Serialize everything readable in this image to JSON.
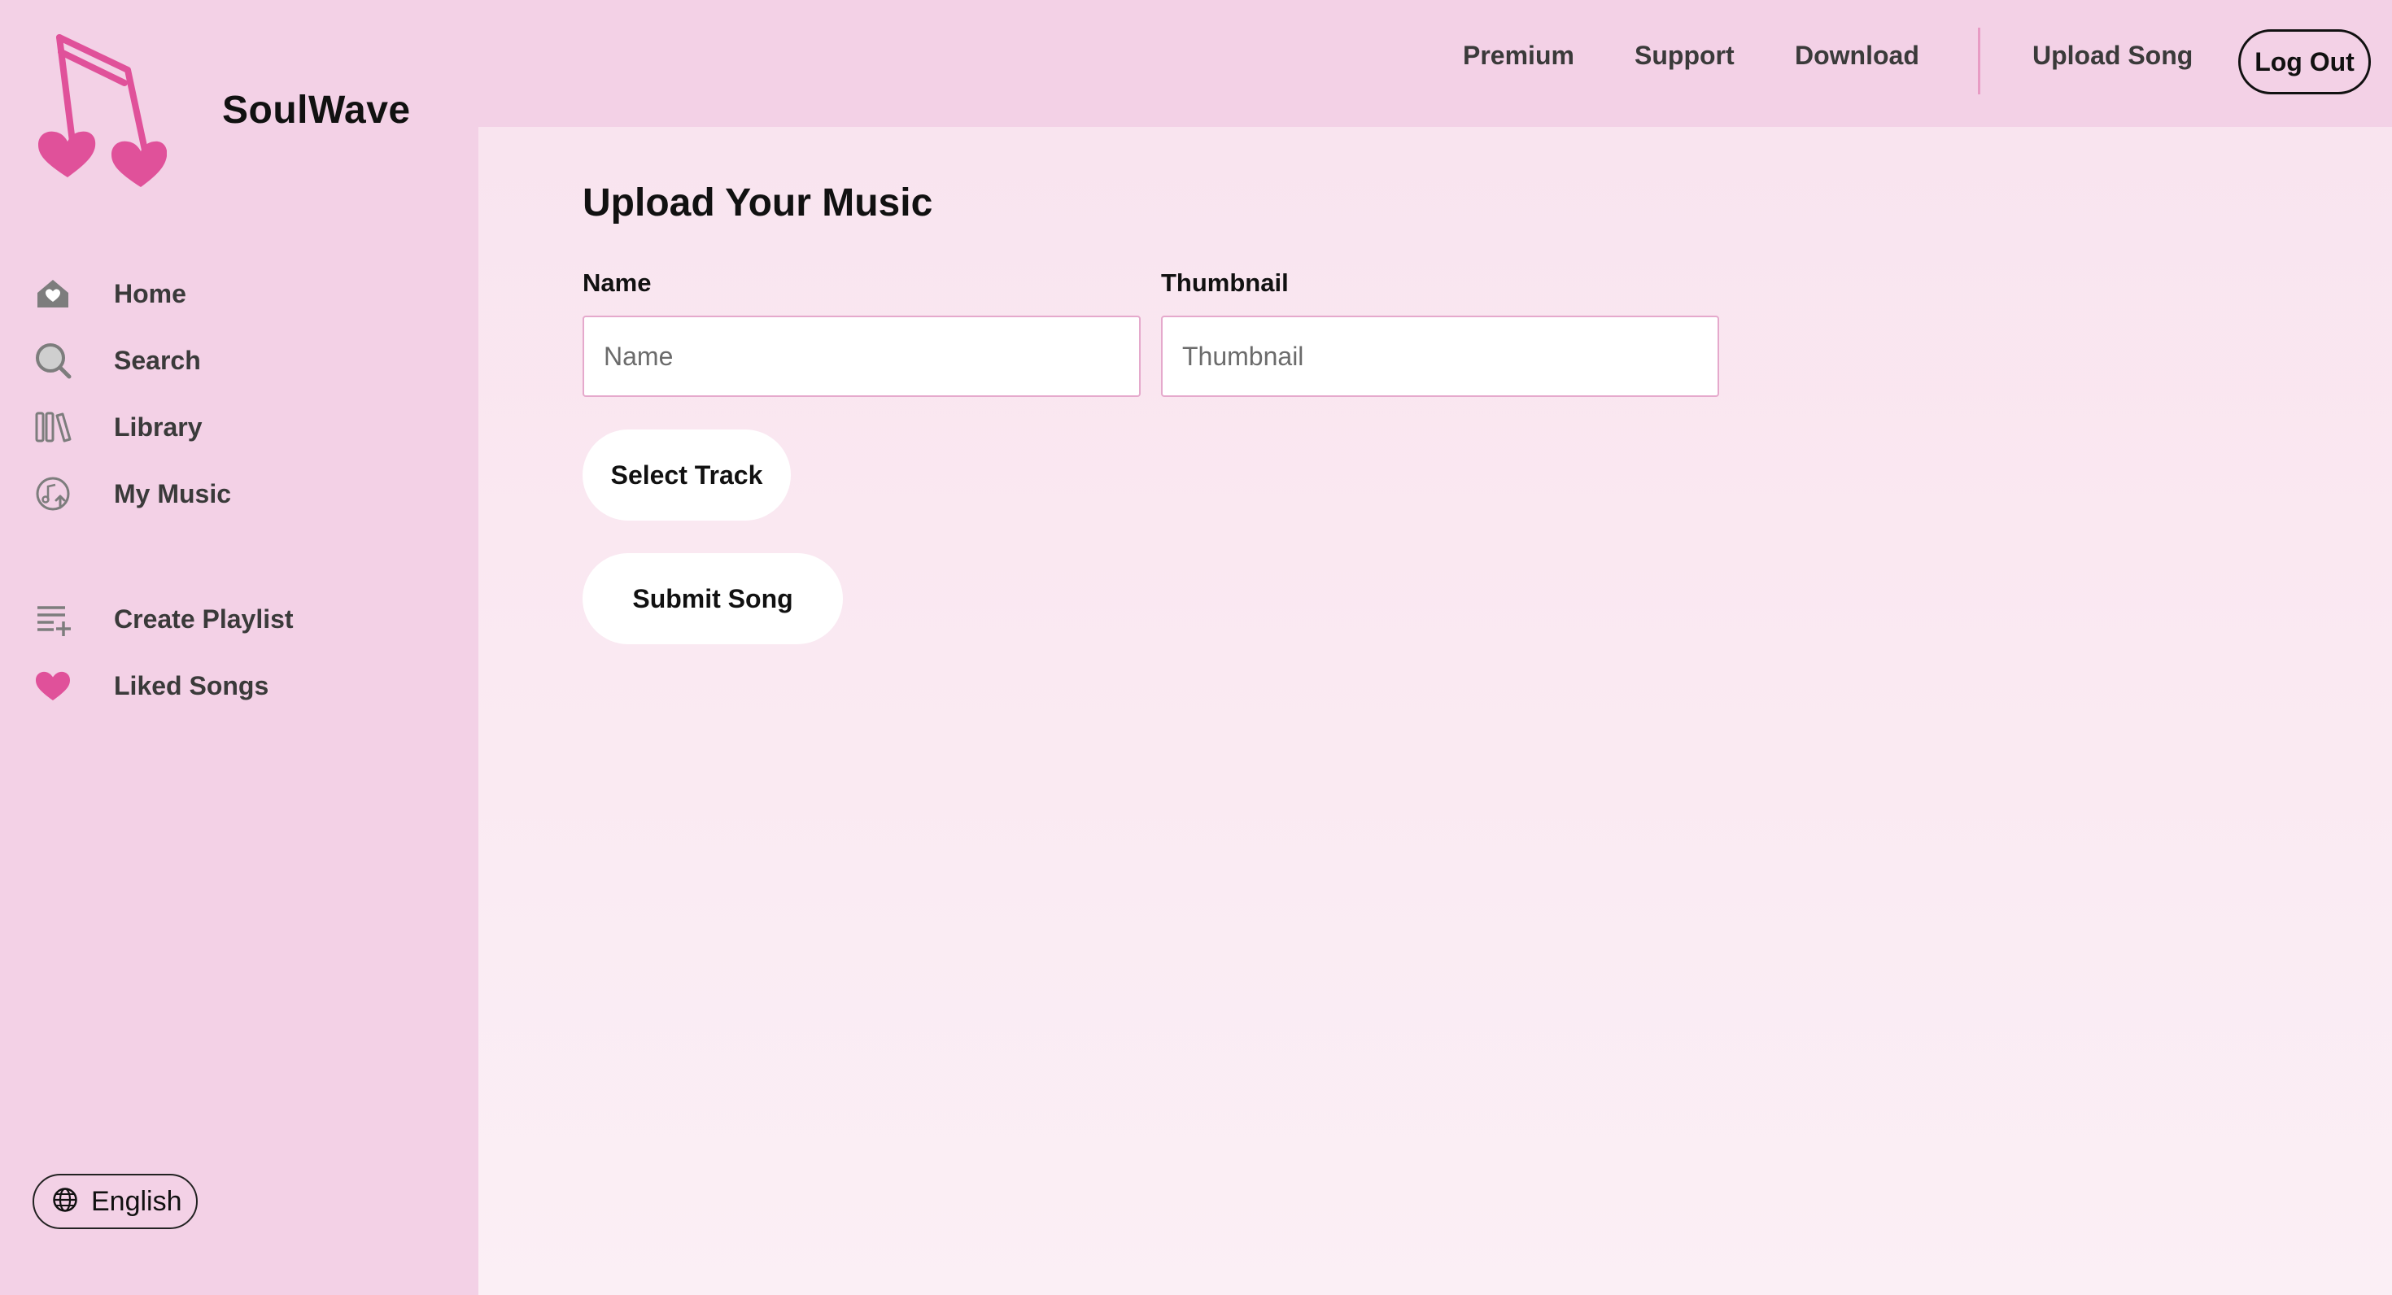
{
  "brand": {
    "name": "SoulWave"
  },
  "sidebar": {
    "primary": [
      {
        "label": "Home",
        "icon": "home-icon"
      },
      {
        "label": "Search",
        "icon": "search-icon"
      },
      {
        "label": "Library",
        "icon": "library-icon"
      },
      {
        "label": "My Music",
        "icon": "my-music-icon"
      }
    ],
    "secondary": [
      {
        "label": "Create Playlist",
        "icon": "create-playlist-icon"
      },
      {
        "label": "Liked Songs",
        "icon": "heart-icon"
      }
    ],
    "language": {
      "label": "English",
      "icon": "globe-icon"
    }
  },
  "topbar": {
    "links": [
      "Premium",
      "Support",
      "Download"
    ],
    "upload_label": "Upload Song",
    "logout_label": "Log Out"
  },
  "main": {
    "title": "Upload Your Music",
    "name_field": {
      "label": "Name",
      "placeholder": "Name",
      "value": ""
    },
    "thumbnail_field": {
      "label": "Thumbnail",
      "placeholder": "Thumbnail",
      "value": ""
    },
    "select_track_label": "Select Track",
    "submit_label": "Submit Song"
  },
  "colors": {
    "sidebar_bg": "#f3d1e6",
    "main_bg": "#f9e4ef",
    "accent_pink": "#e0519a",
    "input_border": "#e5a9cc",
    "divider": "#e89bc4"
  }
}
